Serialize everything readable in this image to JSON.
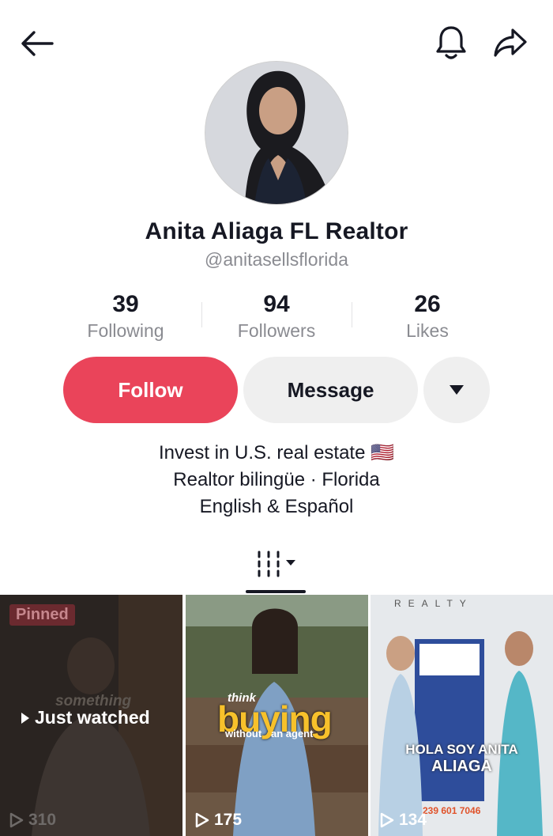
{
  "profile": {
    "name": "Anita Aliaga FL Realtor",
    "handle": "@anitasellsflorida"
  },
  "stats": [
    {
      "value": "39",
      "label": "Following"
    },
    {
      "value": "94",
      "label": "Followers"
    },
    {
      "value": "26",
      "label": "Likes"
    }
  ],
  "actions": {
    "follow_label": "Follow",
    "message_label": "Message"
  },
  "bio": {
    "line1": "Invest in U.S. real estate 🇺🇸",
    "line2": "Realtor bilingüe · Florida",
    "line3": "English & Español"
  },
  "videos": [
    {
      "badge": "Pinned",
      "status": "Just watched",
      "caption": "something",
      "views": "310"
    },
    {
      "overlay": {
        "small_top": "think",
        "big": "buying",
        "small_left": "without",
        "small_right": "an agent"
      },
      "views": "175"
    },
    {
      "overlay": {
        "brand_top": "REALTY",
        "line1": "HOLA SOY ANITA",
        "line2": "ALIAGA",
        "phone": "239 601 7046"
      },
      "views": "134"
    }
  ],
  "colors": {
    "follow": "#ea445a",
    "secondary_button": "#efefef",
    "text_primary": "#161823",
    "text_secondary": "#8a8b91"
  },
  "icons": {
    "back": "arrow-left-icon",
    "notifications": "bell-icon",
    "share": "share-arrow-icon",
    "more": "caret-down-icon",
    "videos_tab": "grid-lines-icon",
    "views": "play-icon"
  }
}
